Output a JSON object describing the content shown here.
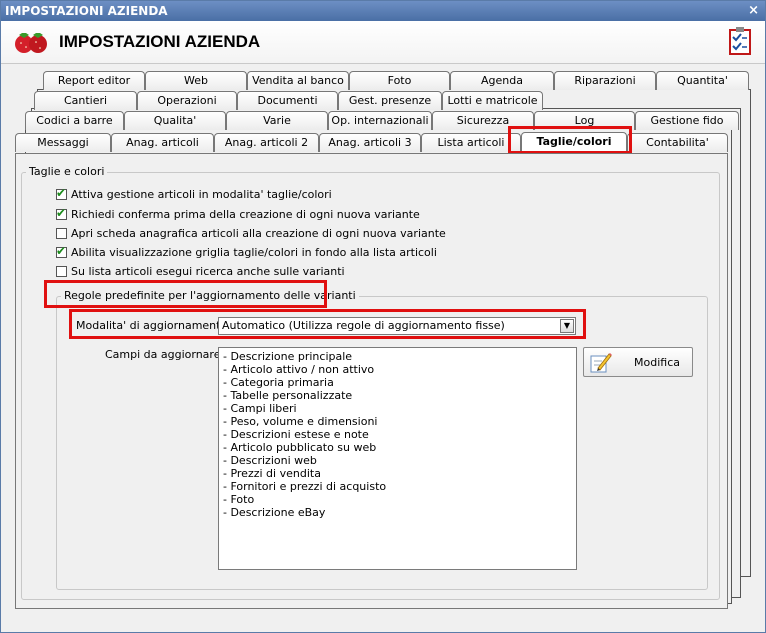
{
  "window": {
    "title": "IMPOSTAZIONI AZIENDA",
    "close_glyph": "×"
  },
  "header": {
    "title": "IMPOSTAZIONI AZIENDA",
    "logo_icon": "strawberries-icon",
    "help_icon": "checklist-clipboard-icon"
  },
  "tabs": {
    "row1": [
      "Report editor",
      "Web",
      "Vendita al banco",
      "Foto",
      "Agenda",
      "Riparazioni",
      "Quantita'"
    ],
    "row2": [
      "Cantieri",
      "Operazioni",
      "Documenti",
      "Gest. presenze",
      "Lotti e matricole"
    ],
    "row3": [
      "Codici a barre",
      "Qualita'",
      "Varie",
      "Op. internazionali",
      "Sicurezza",
      "Log",
      "Gestione fido"
    ],
    "row4": [
      "Messaggi",
      "Anag. articoli",
      "Anag. articoli 2",
      "Anag. articoli 3",
      "Lista articoli",
      "Taglie/colori",
      "Contabilita'"
    ],
    "active": "Taglie/colori"
  },
  "group_main": {
    "legend": "Taglie e colori"
  },
  "checkboxes": [
    {
      "label": "Attiva gestione articoli in modalita' taglie/colori",
      "checked": true
    },
    {
      "label": "Richiedi conferma prima della creazione di ogni nuova variante",
      "checked": true
    },
    {
      "label": "Apri scheda anagrafica articoli alla creazione di ogni nuova variante",
      "checked": false
    },
    {
      "label": "Abilita visualizzazione griglia taglie/colori in fondo alla lista articoli",
      "checked": true
    },
    {
      "label": "Su lista articoli esegui ricerca anche sulle varianti",
      "checked": false
    }
  ],
  "group_rules": {
    "legend": "Regole predefinite per l'aggiornamento delle varianti"
  },
  "mode": {
    "label": "Modalita' di aggiornamento :",
    "value": "Automatico (Utilizza regole di aggiornamento fisse)"
  },
  "fields": {
    "label": "Campi da aggiornare :",
    "items": [
      "- Descrizione principale",
      "- Articolo attivo / non attivo",
      "- Categoria primaria",
      "- Tabelle personalizzate",
      "- Campi liberi",
      "- Peso, volume e dimensioni",
      "- Descrizioni estese e note",
      "- Articolo pubblicato su web",
      "- Descrizioni web",
      "- Prezzi di vendita",
      "- Fornitori e prezzi di acquisto",
      "- Foto",
      "- Descrizione eBay"
    ]
  },
  "modify_button": {
    "label": "Modifica",
    "icon": "pencil-edit-icon"
  },
  "colors": {
    "highlight": "#e01010",
    "titlebar": "#4a6fa5",
    "check": "#1a8a1a"
  }
}
